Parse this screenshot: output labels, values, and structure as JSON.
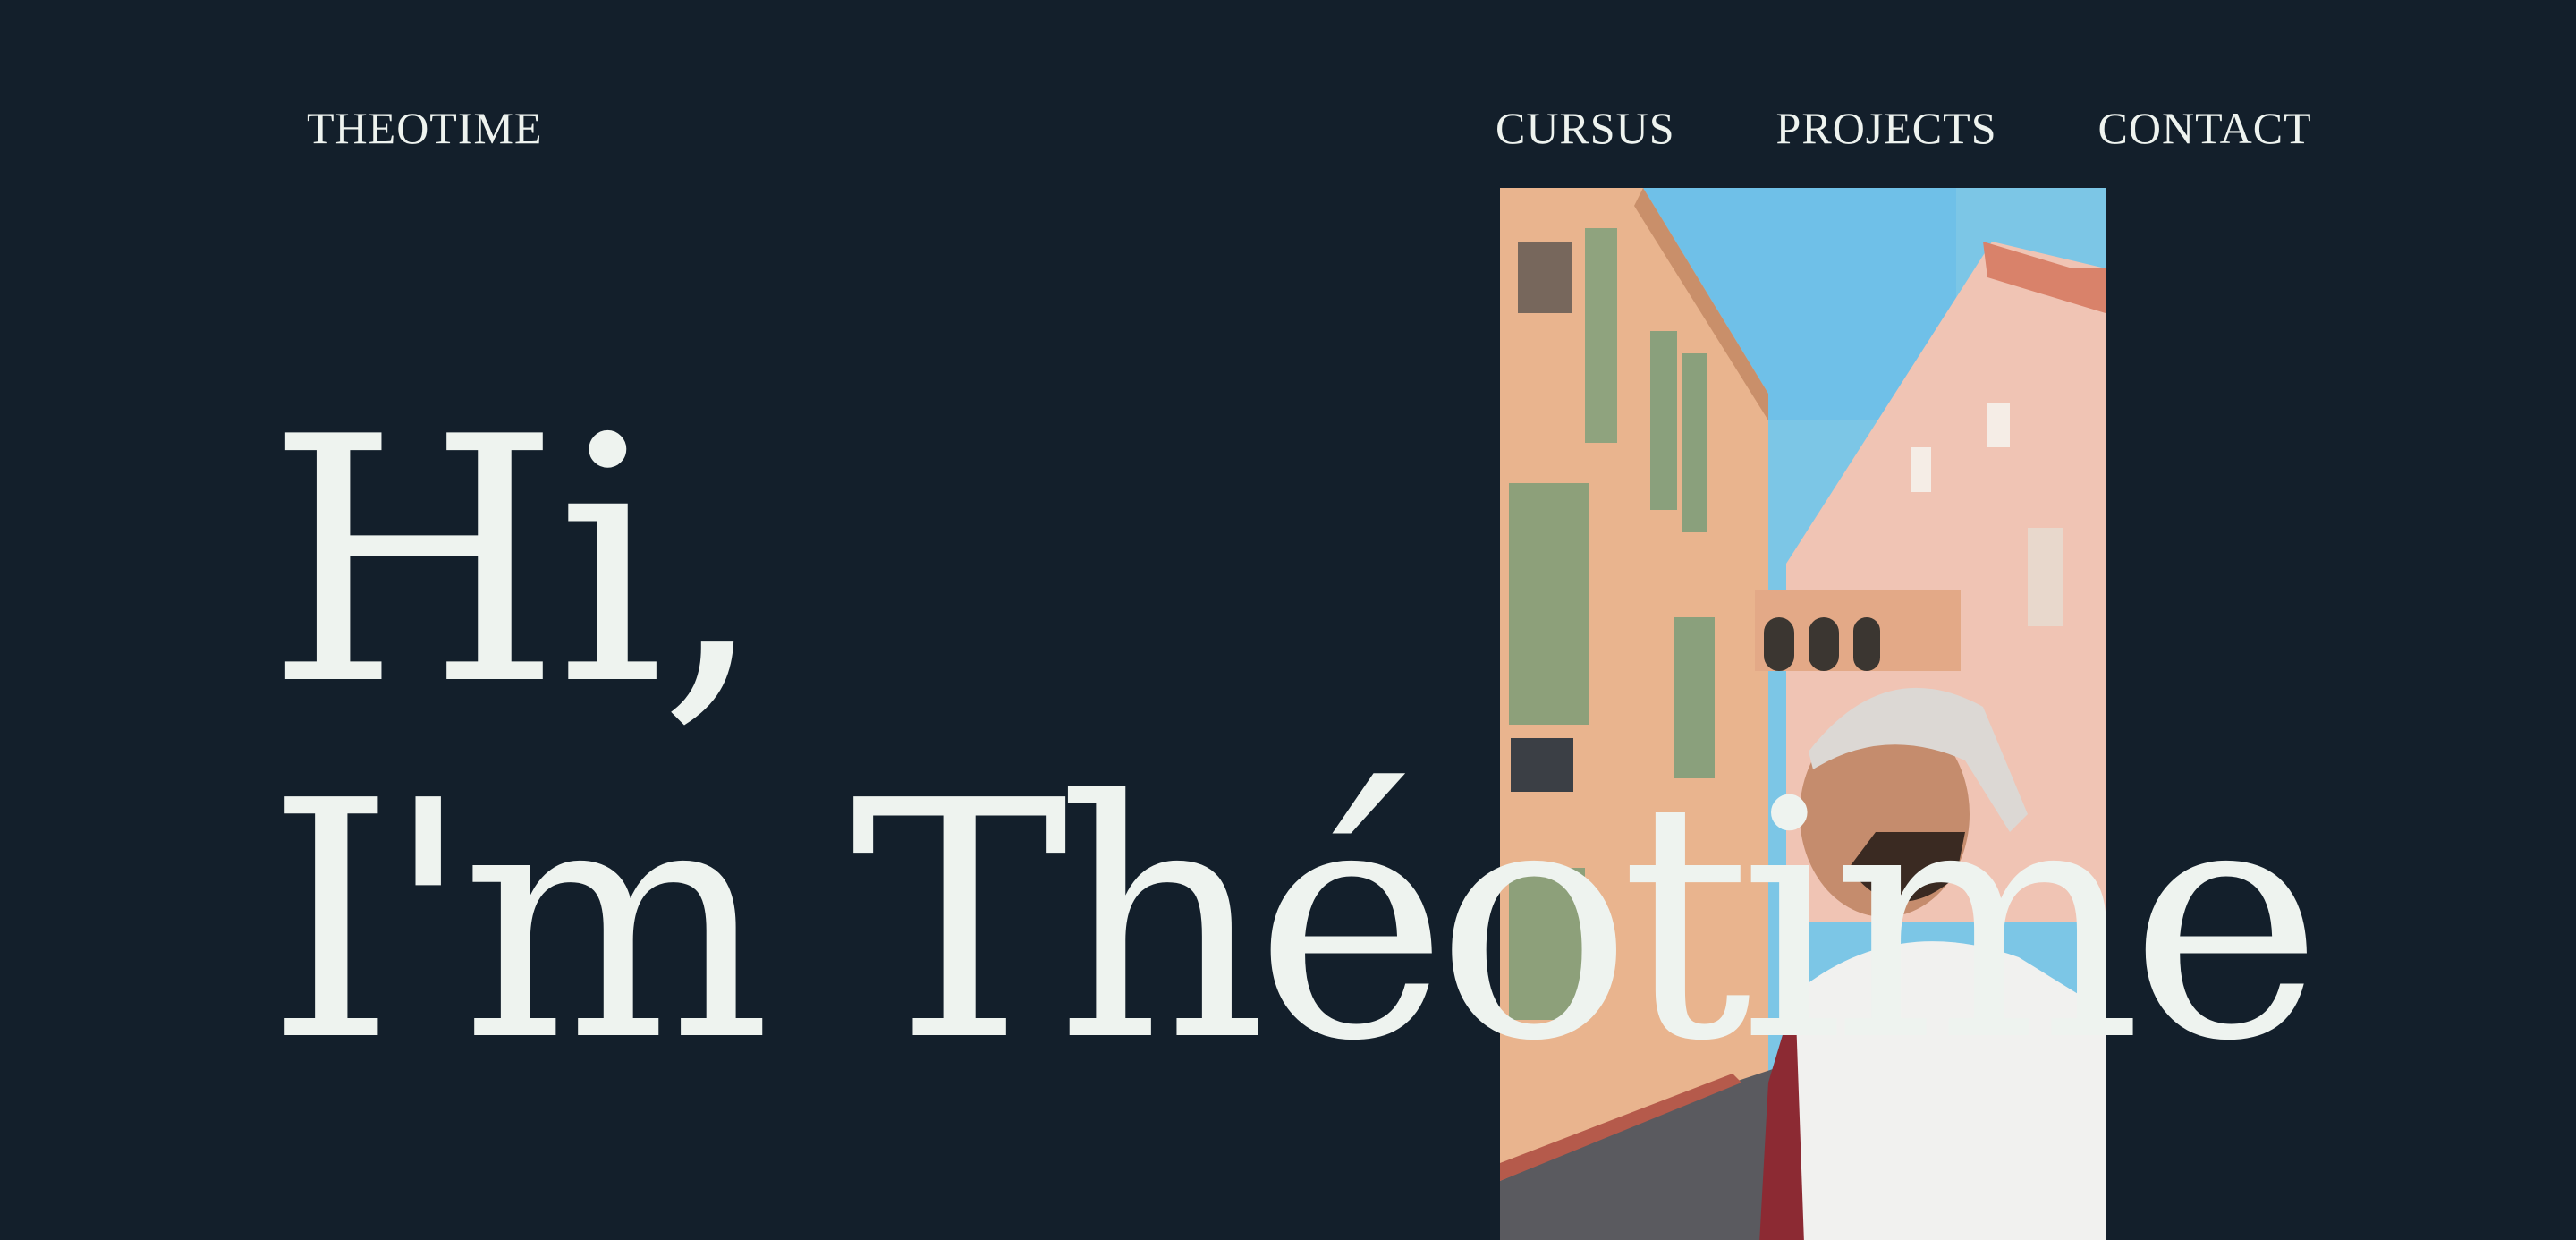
{
  "header": {
    "brand": "THEOTIME",
    "nav": [
      {
        "label": "CURSUS"
      },
      {
        "label": "PROJECTS"
      },
      {
        "label": "CONTACT"
      }
    ]
  },
  "hero": {
    "line1": "Hi,",
    "line2": "I'm Théotime"
  },
  "colors": {
    "background": "#131f2b",
    "text": "#eef3ef"
  },
  "photo": {
    "icon": "portrait-photo"
  }
}
